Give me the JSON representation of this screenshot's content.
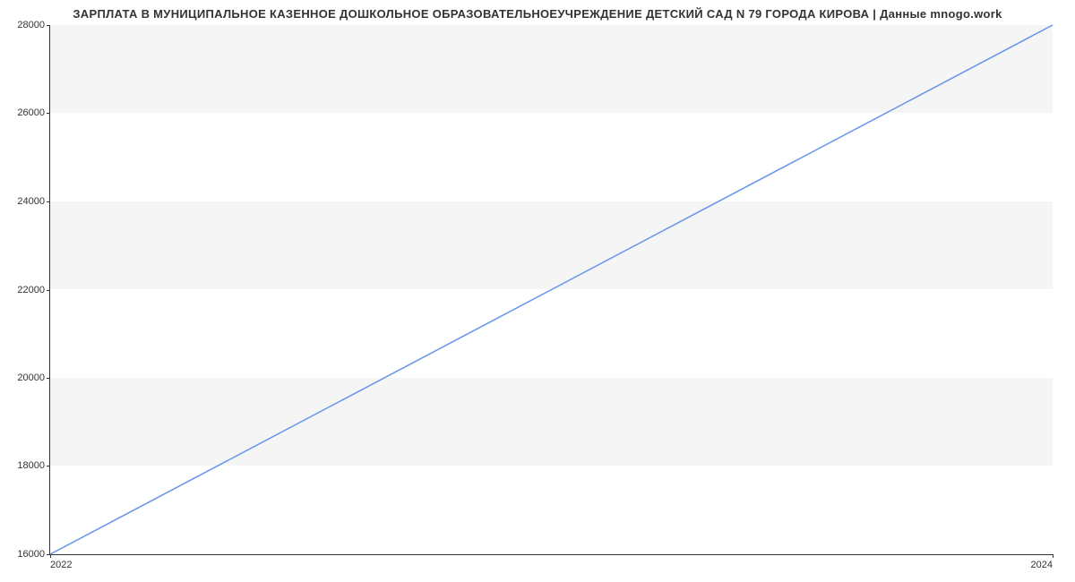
{
  "chart_data": {
    "type": "line",
    "title": "ЗАРПЛАТА В МУНИЦИПАЛЬНОЕ КАЗЕННОЕ ДОШКОЛЬНОЕ ОБРАЗОВАТЕЛЬНОЕУЧРЕЖДЕНИЕ ДЕТСКИЙ САД N 79 ГОРОДА КИРОВА | Данные mnogo.work",
    "x": [
      2022,
      2024
    ],
    "values": [
      16000,
      28000
    ],
    "xlabel": "",
    "ylabel": "",
    "xlim": [
      2022,
      2024
    ],
    "ylim": [
      16000,
      28000
    ],
    "x_ticks": [
      2022,
      2024
    ],
    "y_ticks": [
      16000,
      18000,
      20000,
      22000,
      24000,
      26000,
      28000
    ],
    "line_color": "#6495ed"
  }
}
